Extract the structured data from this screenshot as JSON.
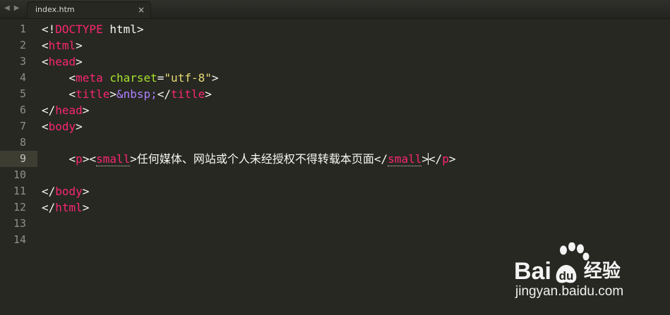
{
  "window": {
    "nav": {
      "back": "◀",
      "forward": "▶"
    },
    "tab": {
      "label": "index.htm",
      "close": "×"
    }
  },
  "editor": {
    "current_line": 9,
    "lines": [
      {
        "n": "1",
        "tokens": [
          {
            "t": "pl",
            "v": "<!"
          },
          {
            "t": "tag",
            "v": "DOCTYPE"
          },
          {
            "t": "pl",
            "v": " html>"
          }
        ]
      },
      {
        "n": "2",
        "tokens": [
          {
            "t": "pl",
            "v": "<"
          },
          {
            "t": "tag",
            "v": "html"
          },
          {
            "t": "pl",
            "v": ">"
          }
        ]
      },
      {
        "n": "3",
        "tokens": [
          {
            "t": "pl",
            "v": "<"
          },
          {
            "t": "tag",
            "v": "head"
          },
          {
            "t": "pl",
            "v": ">"
          }
        ]
      },
      {
        "n": "4",
        "tokens": [
          {
            "t": "pl",
            "v": "    <"
          },
          {
            "t": "tag",
            "v": "meta"
          },
          {
            "t": "pl",
            "v": " "
          },
          {
            "t": "attr",
            "v": "charset"
          },
          {
            "t": "pl",
            "v": "="
          },
          {
            "t": "str",
            "v": "\"utf-8\""
          },
          {
            "t": "pl",
            "v": ">"
          }
        ]
      },
      {
        "n": "5",
        "tokens": [
          {
            "t": "pl",
            "v": "    <"
          },
          {
            "t": "tag",
            "v": "title"
          },
          {
            "t": "pl",
            "v": ">"
          },
          {
            "t": "ent",
            "v": "&nbsp;"
          },
          {
            "t": "pl",
            "v": "</"
          },
          {
            "t": "tag",
            "v": "title"
          },
          {
            "t": "pl",
            "v": ">"
          }
        ]
      },
      {
        "n": "6",
        "tokens": [
          {
            "t": "pl",
            "v": "</"
          },
          {
            "t": "tag",
            "v": "head"
          },
          {
            "t": "pl",
            "v": ">"
          }
        ]
      },
      {
        "n": "7",
        "tokens": [
          {
            "t": "pl",
            "v": "<"
          },
          {
            "t": "tag",
            "v": "body"
          },
          {
            "t": "pl",
            "v": ">"
          }
        ]
      },
      {
        "n": "8",
        "tokens": []
      },
      {
        "n": "9",
        "tokens": [
          {
            "t": "pl",
            "v": "    <"
          },
          {
            "t": "tag",
            "v": "p"
          },
          {
            "t": "pl",
            "v": "><"
          },
          {
            "t": "tag matched",
            "v": "small"
          },
          {
            "t": "pl",
            "v": ">"
          },
          {
            "t": "cjk",
            "v": "任何媒体、网站或个人未经授权不得转载本页面"
          },
          {
            "t": "pl",
            "v": "</"
          },
          {
            "t": "tag matched",
            "v": "small"
          },
          {
            "t": "pl",
            "v": ">"
          },
          {
            "t": "caret",
            "v": ""
          },
          {
            "t": "pl",
            "v": "</"
          },
          {
            "t": "tag",
            "v": "p"
          },
          {
            "t": "pl",
            "v": ">"
          }
        ]
      },
      {
        "n": "10",
        "tokens": []
      },
      {
        "n": "11",
        "tokens": [
          {
            "t": "pl",
            "v": "</"
          },
          {
            "t": "tag",
            "v": "body"
          },
          {
            "t": "pl",
            "v": ">"
          }
        ]
      },
      {
        "n": "12",
        "tokens": [
          {
            "t": "pl",
            "v": "</"
          },
          {
            "t": "tag",
            "v": "html"
          },
          {
            "t": "pl",
            "v": ">"
          }
        ]
      },
      {
        "n": "13",
        "tokens": []
      },
      {
        "n": "14",
        "tokens": []
      }
    ]
  },
  "watermark": {
    "brand_left": "Bai",
    "brand_right": "du",
    "brand_cn": "经验",
    "url": "jingyan.baidu.com",
    "paw_icon": "baidu-paw-icon"
  },
  "colors": {
    "background": "#272822",
    "tag": "#f92672",
    "attribute": "#a6e22e",
    "string": "#e6db74",
    "entity": "#ae81ff",
    "text": "#f8f8f2",
    "line_number": "#90908a",
    "current_line": "#3e3d32"
  }
}
